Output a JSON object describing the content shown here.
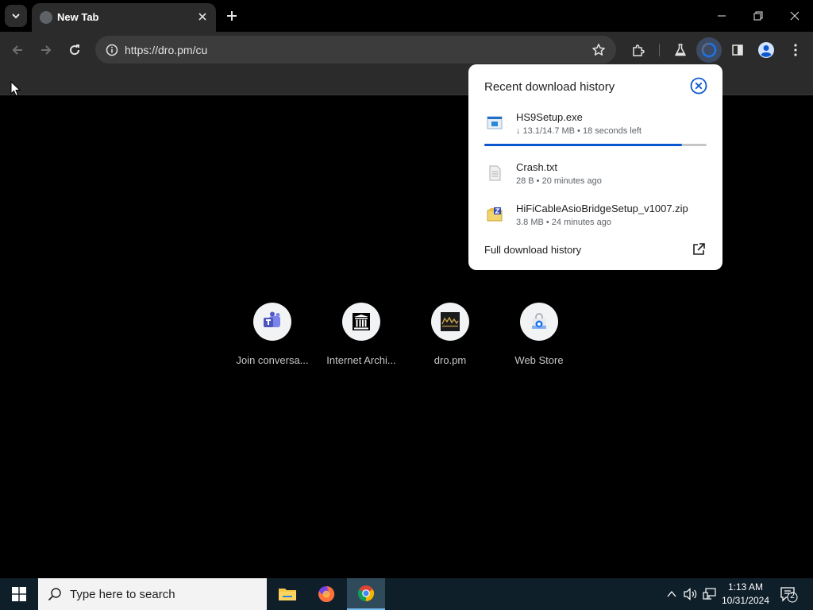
{
  "browser": {
    "tab": {
      "title": "New Tab"
    },
    "omnibox": {
      "url": "https://dro.pm/cu"
    }
  },
  "colors": {
    "accent": "#0b57d0",
    "toolbar_bg": "#2b2b2b",
    "taskbar_bg": "#0f1f2a"
  },
  "shortcuts": [
    {
      "label": "Join conversa...",
      "icon": "teams-icon"
    },
    {
      "label": "Internet Archi...",
      "icon": "archive-icon"
    },
    {
      "label": "dro.pm",
      "icon": "dropm-icon"
    },
    {
      "label": "Web Store",
      "icon": "webstore-icon"
    }
  ],
  "downloads": {
    "title": "Recent download history",
    "items": [
      {
        "name": "HS9Setup.exe",
        "status": "↓ 13.1/14.7 MB • 18 seconds left",
        "progress": 0.89,
        "icon": "exe-file-icon"
      },
      {
        "name": "Crash.txt",
        "status": "28 B • 20 minutes ago",
        "icon": "text-file-icon"
      },
      {
        "name": "HiFiCableAsioBridgeSetup_v1007.zip",
        "status": "3.8 MB • 24 minutes ago",
        "icon": "zip-file-icon"
      }
    ],
    "full_history_label": "Full download history"
  },
  "taskbar": {
    "search_placeholder": "Type here to search",
    "time": "1:13 AM",
    "date": "10/31/2024",
    "notification_count": "2"
  }
}
